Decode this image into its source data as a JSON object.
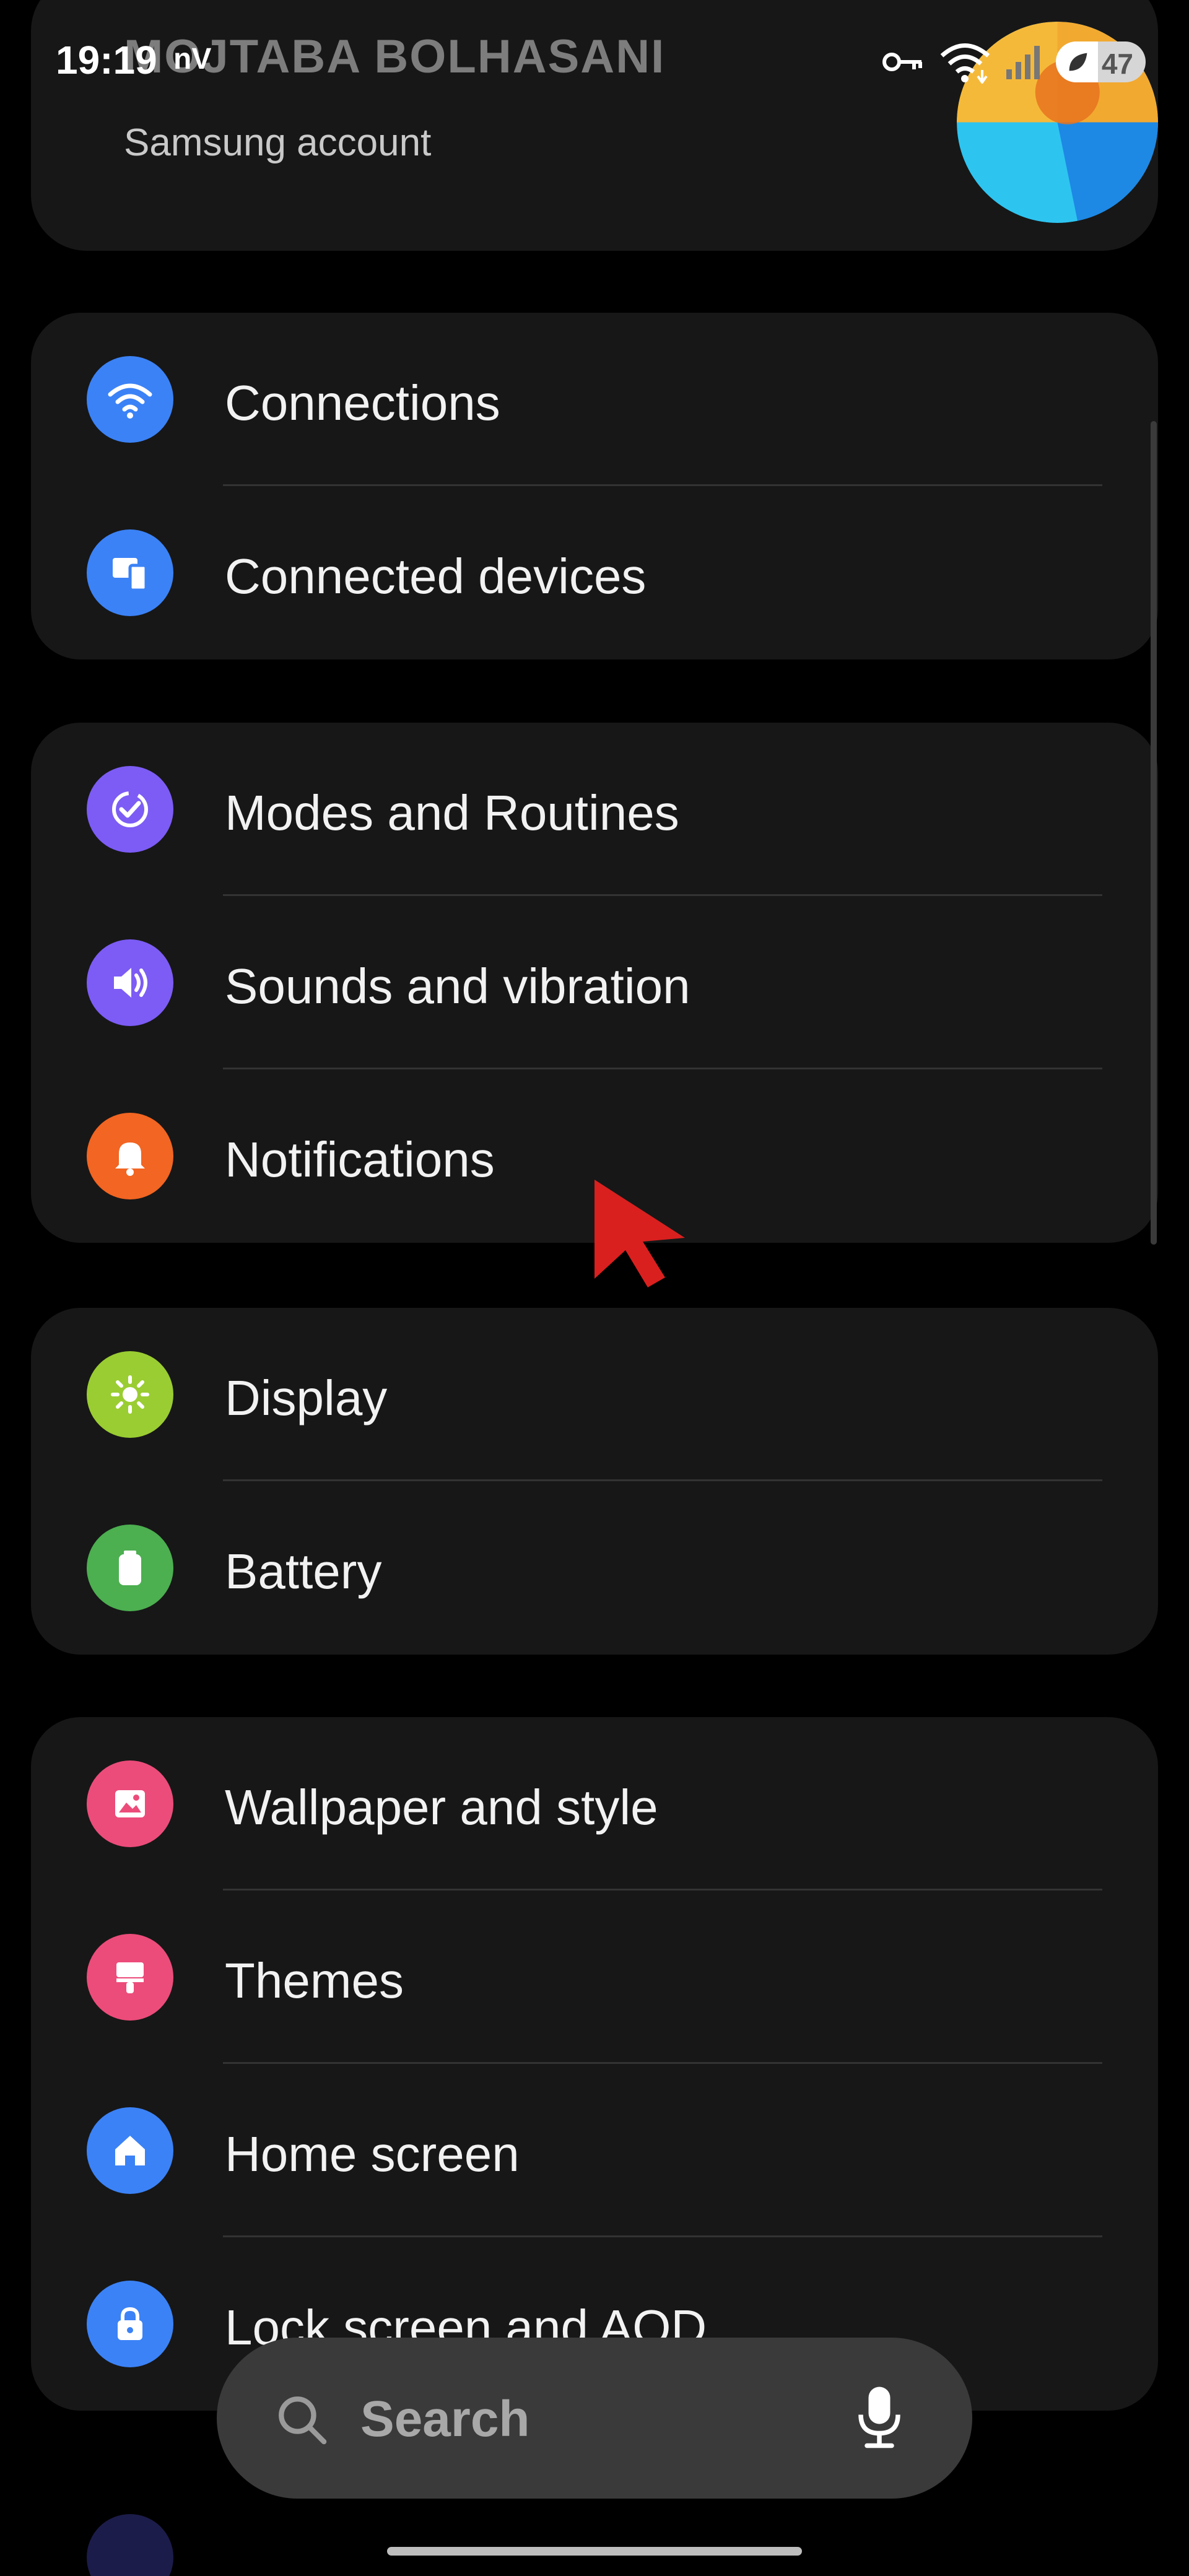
{
  "status_bar": {
    "time": "19:19",
    "network_label": "nV",
    "battery_level": "47",
    "battery_fraction": 0.47
  },
  "account": {
    "name": "MOJTABA BOLHASANI",
    "subtitle": "Samsung account",
    "avatar_colors": [
      "#F2A930",
      "#E8731E",
      "#2EC4F0",
      "#1E88E5"
    ]
  },
  "groups": [
    {
      "items": [
        {
          "label": "Connections",
          "icon": "wifi-icon",
          "color": "#3B82F6"
        },
        {
          "label": "Connected devices",
          "icon": "devices-icon",
          "color": "#3B82F6"
        }
      ]
    },
    {
      "items": [
        {
          "label": "Modes and Routines",
          "icon": "routine-check-icon",
          "color": "#7C5CF5"
        },
        {
          "label": "Sounds and vibration",
          "icon": "speaker-icon",
          "color": "#7C5CF5"
        },
        {
          "label": "Notifications",
          "icon": "bell-icon",
          "color": "#F26522"
        }
      ]
    },
    {
      "items": [
        {
          "label": "Display",
          "icon": "sun-icon",
          "color": "#9ACD32"
        },
        {
          "label": "Battery",
          "icon": "battery-icon",
          "color": "#4CAF50"
        }
      ]
    },
    {
      "items": [
        {
          "label": "Wallpaper and style",
          "icon": "image-icon",
          "color": "#EC4C7A"
        },
        {
          "label": "Themes",
          "icon": "paintbrush-icon",
          "color": "#EC4C7A"
        },
        {
          "label": "Home screen",
          "icon": "home-icon",
          "color": "#3B82F6"
        },
        {
          "label": "Lock screen and AOD",
          "icon": "lock-icon",
          "color": "#3B82F6"
        }
      ]
    }
  ],
  "search": {
    "placeholder": "Search"
  },
  "pointer_color": "#D9201F"
}
